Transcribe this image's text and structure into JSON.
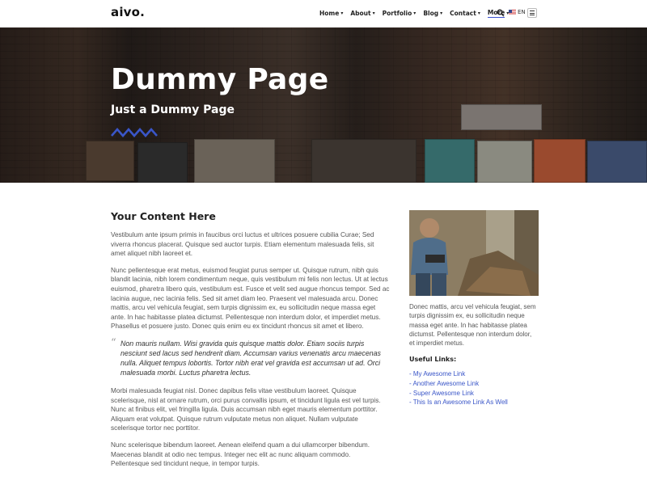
{
  "header": {
    "logo": "aivo.",
    "nav": [
      {
        "label": "Home",
        "caret": "▾"
      },
      {
        "label": "About",
        "caret": "▾"
      },
      {
        "label": "Portfolio",
        "caret": "▾"
      },
      {
        "label": "Blog",
        "caret": "▾"
      },
      {
        "label": "Contact",
        "caret": "▾"
      },
      {
        "label": "More",
        "caret": "▾"
      }
    ],
    "language": "EN"
  },
  "hero": {
    "title": "Dummy Page",
    "subtitle": "Just a Dummy Page",
    "accent_color": "#3a56c8"
  },
  "main": {
    "title": "Your Content Here",
    "paragraphs": [
      "Vestibulum ante ipsum primis in faucibus orci luctus et ultrices posuere cubilia Curae; Sed viverra rhoncus placerat. Quisque sed auctor turpis. Etiam elementum malesuada felis, sit amet aliquet nibh laoreet et.",
      "Nunc pellentesque erat metus, euismod feugiat purus semper ut. Quisque rutrum, nibh quis blandit lacinia, nibh lorem condimentum neque, quis vestibulum mi felis non lectus. Ut at lectus euismod, pharetra libero quis, vestibulum est. Fusce et velit sed augue rhoncus tempor. Sed ac lacinia augue, nec lacinia felis. Sed sit amet diam leo. Praesent vel malesuada arcu. Donec mattis, arcu vel vehicula feugiat, sem turpis dignissim ex, eu sollicitudin neque massa eget ante. In hac habitasse platea dictumst. Pellentesque non interdum dolor, et imperdiet metus. Phasellus et posuere justo. Donec quis enim eu ex tincidunt rhoncus sit amet et libero."
    ],
    "quote_mark": "“",
    "quote": "Non mauris nullam. Wisi gravida quis quisque mattis dolor. Etiam sociis turpis nesciunt sed lacus sed hendrerit diam. Accumsan varius venenatis arcu maecenas nulla. Aliquet tempus lobortis. Tortor nibh erat vel gravida est accumsan ut ad. Orci malesuada morbi. Luctus pharetra lectus.",
    "paragraphs_after": [
      "Morbi malesuada feugiat nisl. Donec dapibus felis vitae vestibulum laoreet. Quisque scelerisque, nisl at ornare rutrum, orci purus convallis ipsum, et tincidunt ligula est vel turpis. Nunc at finibus elit, vel fringilla ligula. Duis accumsan nibh eget mauris elementum porttitor. Aliquam erat volutpat. Quisque rutrum vulputate metus non aliquet. Nullam vulputate scelerisque tortor nec porttitor.",
      "Nunc scelerisque bibendum laoreet. Aenean eleifend quam a dui ullamcorper bibendum. Maecenas blandit at odio nec tempus. Integer nec elit ac nunc aliquam commodo. Pellentesque sed tincidunt neque, in tempor turpis."
    ]
  },
  "sidebar": {
    "text": "Donec mattis, arcu vel vehicula feugiat, sem turpis dignissim ex, eu sollicitudin neque massa eget ante. In hac habitasse platea dictumst. Pellentesque non interdum dolor, et imperdiet metus.",
    "links_title": "Useful Links:",
    "links": [
      "- My Awesome Link",
      "- Another Awesome Link",
      "- Super Awesome Link",
      "- This Is an Awesome Link As Well"
    ]
  }
}
